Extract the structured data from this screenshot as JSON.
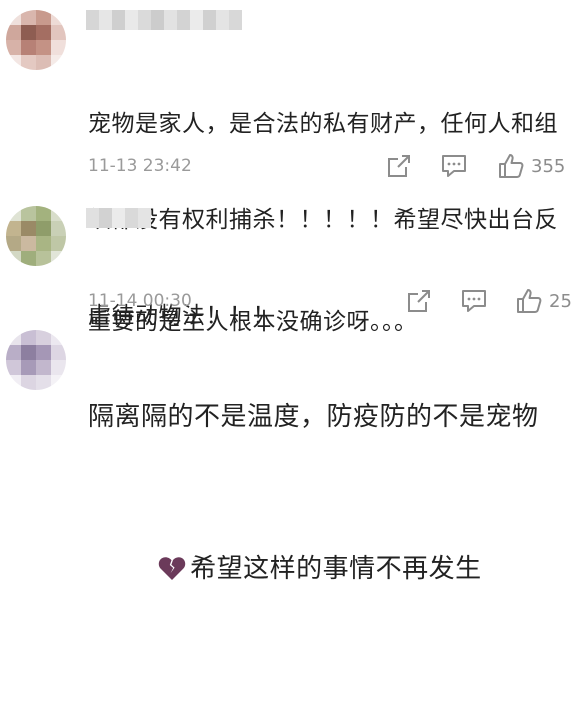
{
  "comments": [
    {
      "text_lines": [
        "宠物是家人，是合法的私有财产，任何人和组",
        "织都没有权利捕杀！！！！！希望尽快出台反",
        "虐待动物法！！！"
      ],
      "timestamp": "11-13 23:42",
      "like_count": "355"
    },
    {
      "text_lines": [
        "重要的是主人根本没确诊呀。。。"
      ],
      "timestamp": "11-14 00:30",
      "like_count": "25"
    },
    {
      "text_lines": [
        "隔离隔的不是温度，防疫防的不是宠物",
        "希望这样的事情不再发生"
      ],
      "emoji": "broken-heart-icon"
    }
  ],
  "icons": {
    "share": "share-icon",
    "comment": "comment-icon",
    "like": "thumbs-up-icon"
  },
  "colors": {
    "text": "#222222",
    "meta": "#9a9a9a",
    "icon": "#8c8c8c",
    "broken_heart": "#6b3a5a"
  }
}
